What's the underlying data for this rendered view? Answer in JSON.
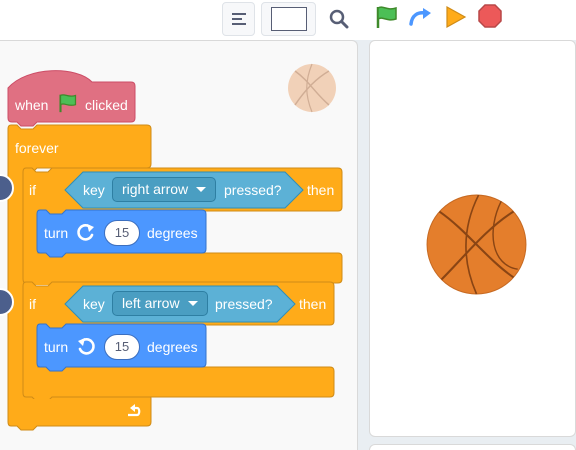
{
  "toolbar": {
    "list_view_icon": "list-lines-icon",
    "zoom_icon": "magnifier-icon",
    "green_flag_icon": "green-flag-icon",
    "turbo_icon": "turbo-arrow-icon",
    "start_icon": "play-triangle-icon",
    "stop_icon": "stop-octagon-icon"
  },
  "colors": {
    "events": "#e07082",
    "control": "#ffab19",
    "sensing": "#5cb1d6",
    "motion": "#4c97ff",
    "basketball": "#e47e2c"
  },
  "script": {
    "hat": {
      "when": "when",
      "clicked": "clicked"
    },
    "forever": "forever",
    "if1": {
      "if": "if",
      "key": "key",
      "key_option": "right arrow",
      "pressed": "pressed?",
      "then": "then",
      "turn": "turn",
      "value": "15",
      "degrees": "degrees",
      "direction_icon": "rotate-clockwise-icon"
    },
    "if2": {
      "if": "if",
      "key": "key",
      "key_option": "left arrow",
      "pressed": "pressed?",
      "then": "then",
      "turn": "turn",
      "value": "15",
      "degrees": "degrees",
      "direction_icon": "rotate-counterclockwise-icon"
    },
    "loop_icon": "loop-arrow-icon"
  },
  "sprite": {
    "name_icon": "basketball-icon"
  }
}
